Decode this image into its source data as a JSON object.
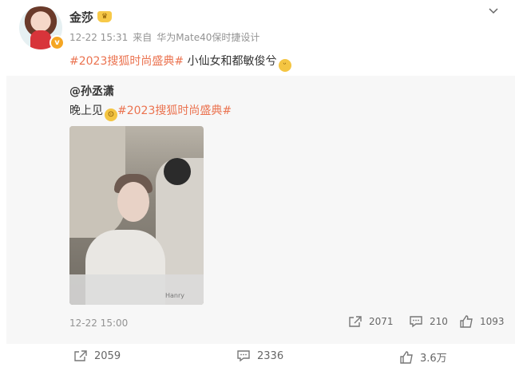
{
  "post": {
    "author": "金莎",
    "timestamp": "12-22 15:31",
    "source_prefix": "来自",
    "source_device": "华为Mate40保时捷设计",
    "hashtag": "#2023搜狐时尚盛典#",
    "text": " 小仙女和都敏俊兮",
    "icons": {
      "avatar": "avatar",
      "verified": "verified-badge-icon",
      "crown": "crown-badge-icon",
      "menu": "chevron-down-icon",
      "emoji": "emoji-icon"
    }
  },
  "repost": {
    "author": "@孙丞潇",
    "text": "晚上见",
    "hashtag": "#2023搜狐时尚盛典#",
    "watermark": "Hanry",
    "time": "12-22 15:00",
    "share_count": "2071",
    "comment_count": "210",
    "like_count": "1093"
  },
  "footer": {
    "share_count": "2059",
    "comment_count": "2336",
    "like_count": "3.6万"
  },
  "colors": {
    "hashtag": "#eb7350",
    "meta": "#939393",
    "repost_bg": "#f7f7f7"
  }
}
